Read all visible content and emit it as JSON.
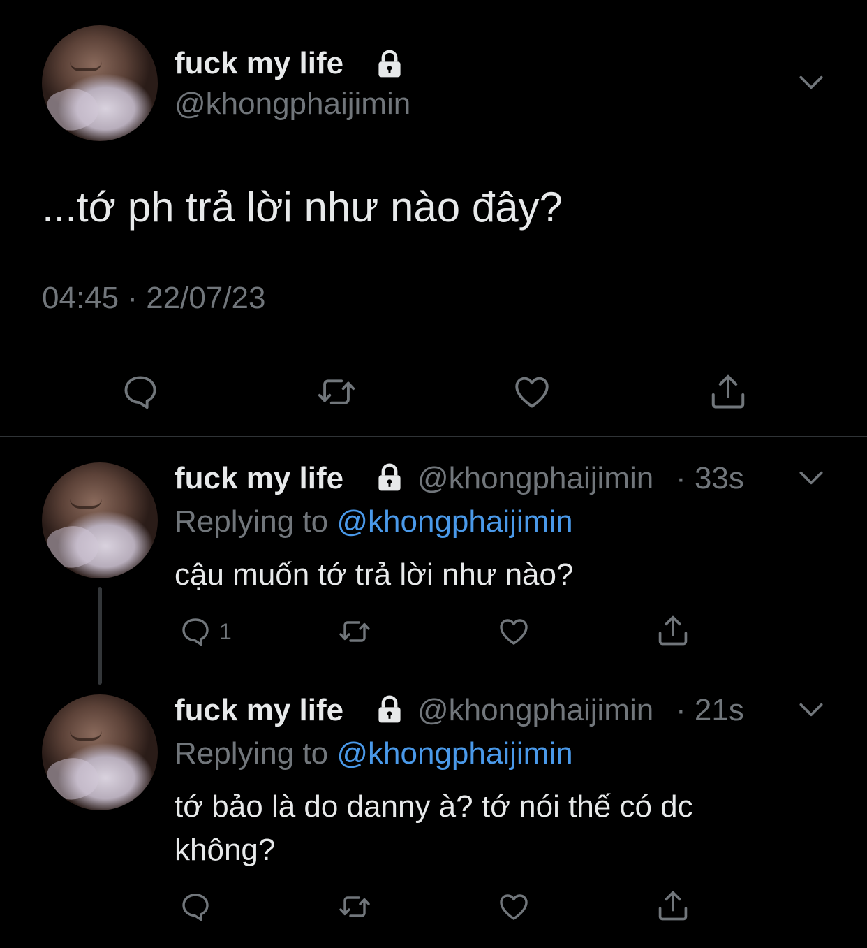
{
  "main_tweet": {
    "name": "fuck my life",
    "handle": "@khongphaijimin",
    "text": "...tớ ph trả lời như nào đây?",
    "timestamp": "04:45 · 22/07/23"
  },
  "replies": [
    {
      "name": "fuck my life",
      "handle": "@khongphaijimin",
      "time": "· 33s",
      "replying_prefix": "Replying to ",
      "replying_mention": "@khongphaijimin",
      "text": "cậu muốn tớ trả lời như nào?",
      "reply_count": "1"
    },
    {
      "name": "fuck my life",
      "handle": "@khongphaijimin",
      "time": "· 21s",
      "replying_prefix": "Replying to ",
      "replying_mention": "@khongphaijimin",
      "text_line1": "tớ bảo là do danny à? tớ nói thế có dc",
      "text_line2": "không?"
    }
  ],
  "colors": {
    "background": "#000000",
    "text": "#e7e9ea",
    "muted": "#71767b",
    "accent": "#4a99e9",
    "divider": "#2f3336"
  },
  "icons": [
    "lock-icon",
    "chevron-down-icon",
    "reply-icon",
    "retweet-icon",
    "like-icon",
    "share-icon"
  ]
}
